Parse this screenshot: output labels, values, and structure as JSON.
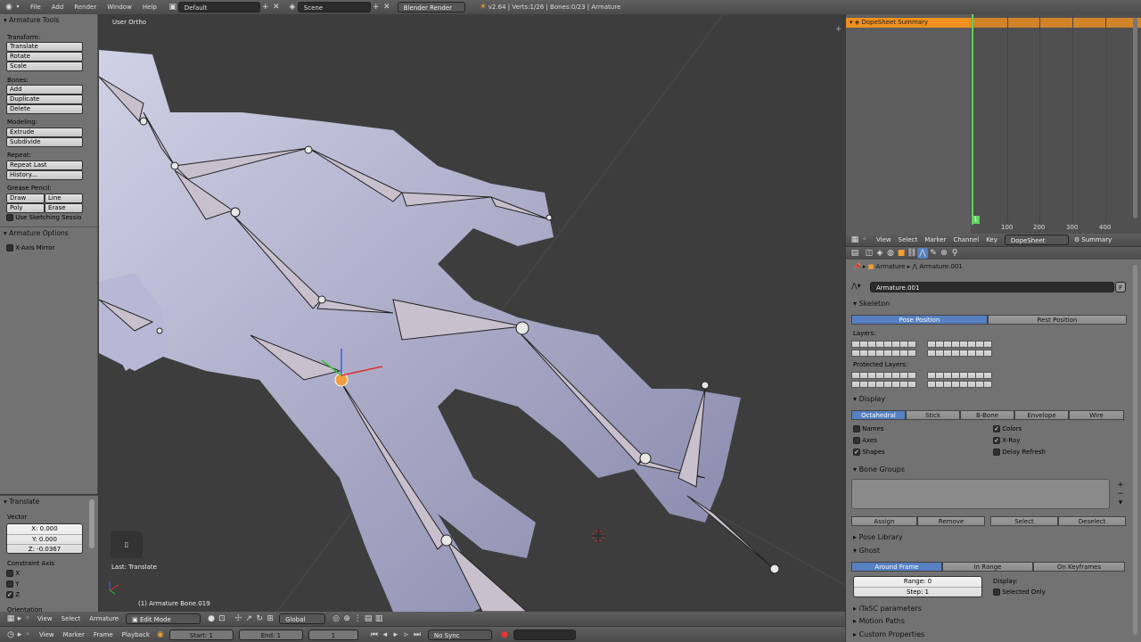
{
  "topbar": {
    "menus": [
      "File",
      "Add",
      "Render",
      "Window",
      "Help"
    ],
    "screen_layout": "Default",
    "scene": "Scene",
    "engine": "Blender Render",
    "stats": "v2.64 | Verts:1/26 | Bones:0/23 | Armature"
  },
  "tools": {
    "title": "Armature Tools",
    "transform_label": "Transform:",
    "translate": "Translate",
    "rotate": "Rotate",
    "scale": "Scale",
    "bones_label": "Bones:",
    "add": "Add",
    "duplicate": "Duplicate",
    "delete": "Delete",
    "modeling_label": "Modeling:",
    "extrude": "Extrude",
    "subdivide": "Subdivide",
    "repeat_label": "Repeat:",
    "repeat_last": "Repeat Last",
    "history": "History...",
    "grease_label": "Grease Pencil:",
    "draw": "Draw",
    "line": "Line",
    "poly": "Poly",
    "erase": "Erase",
    "sketching": "Use Sketching Sessio",
    "options_title": "Armature Options",
    "xmirror": "X-Axis Mirror"
  },
  "operator": {
    "title": "Translate",
    "vector_label": "Vector",
    "x": "X: 0.000",
    "y": "Y: 0.000",
    "z": "Z: -0.0367",
    "constraint_label": "Constraint Axis",
    "cx": "X",
    "cy": "Y",
    "cz": "Z",
    "orientation": "Orientation"
  },
  "viewport": {
    "view_label": "User Ortho",
    "last_op": "Last: Translate",
    "active": "(1) Armature Bone.019"
  },
  "view3d_header": {
    "view": "View",
    "select": "Select",
    "armature": "Armature",
    "mode": "Edit Mode",
    "orientation": "Global"
  },
  "timeline": {
    "view": "View",
    "marker": "Marker",
    "frame": "Frame",
    "playback": "Playback",
    "start": "Start: 1",
    "end": "End: 1",
    "current": "1",
    "sync": "No Sync"
  },
  "dopesheet": {
    "summary": "DopeSheet Summary",
    "ticks": [
      "100",
      "200",
      "300",
      "400"
    ],
    "current_frame": "1",
    "menus": [
      "View",
      "Select",
      "Marker",
      "Channel",
      "Key"
    ],
    "mode": "DopeSheet",
    "summary_btn": "Summary"
  },
  "properties": {
    "crumb1": "Armature",
    "crumb2": "Armature.001",
    "datablock": "Armature.001",
    "fake": "F",
    "skeleton": "Skeleton",
    "pose_position": "Pose Position",
    "rest_position": "Rest Position",
    "layers": "Layers:",
    "protected_layers": "Protected Layers:",
    "display": "Display",
    "display_modes": [
      "Octahedral",
      "Stick",
      "B-Bone",
      "Envelope",
      "Wire"
    ],
    "names": "Names",
    "axes": "Axes",
    "shapes": "Shapes",
    "colors": "Colors",
    "xray": "X-Ray",
    "delay_refresh": "Delay Refresh",
    "bone_groups": "Bone Groups",
    "assign": "Assign",
    "remove": "Remove",
    "select": "Select",
    "deselect": "Deselect",
    "pose_library": "Pose Library",
    "ghost": "Ghost",
    "ghost_modes": [
      "Around Frame",
      "In Range",
      "On Keyframes"
    ],
    "range": "Range: 0",
    "step": "Step: 1",
    "display_label": "Display:",
    "selected_only": "Selected Only",
    "itasc": "iTaSC parameters",
    "motion_paths": "Motion Paths",
    "custom_props": "Custom Properties"
  },
  "colors": {
    "accent": "#5680c2",
    "summary": "#f0901e",
    "frame_line": "#5fd35f"
  }
}
